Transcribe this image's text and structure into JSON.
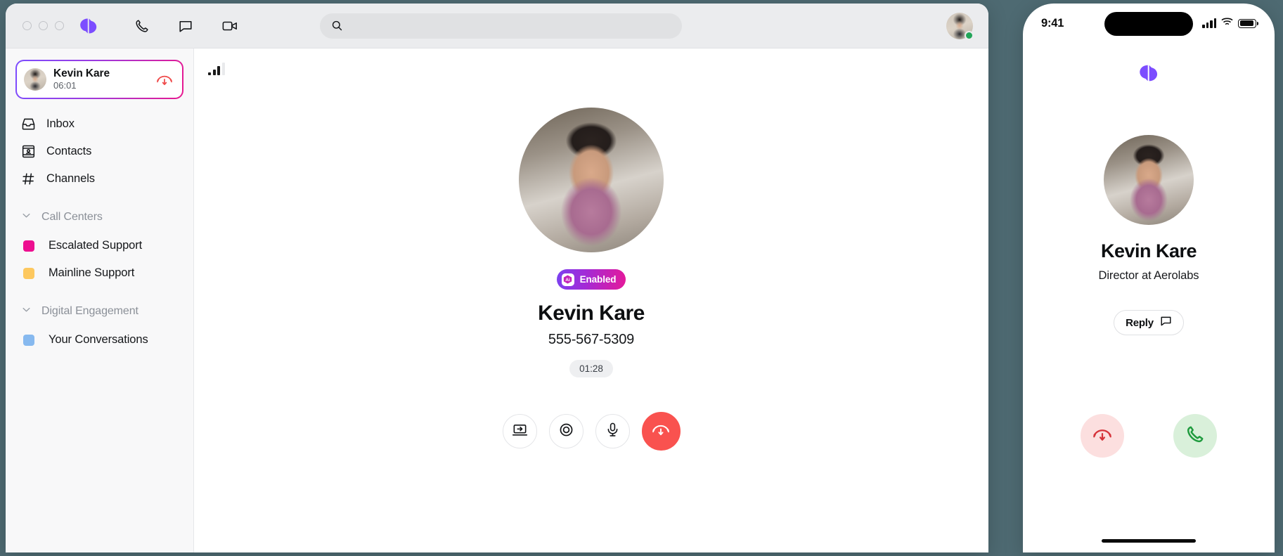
{
  "window": {
    "traffic_lights": [
      "close",
      "minimize",
      "zoom"
    ],
    "brand": "dialpad-logo",
    "toolbar_icons": [
      "phone-icon",
      "message-icon",
      "video-icon"
    ],
    "search": {
      "value": "",
      "placeholder": ""
    },
    "user_avatar": {
      "name": "avatar",
      "presence": "online",
      "presence_color": "#22a559"
    }
  },
  "sidebar": {
    "active_call": {
      "name": "Kevin Kare",
      "duration": "06:01",
      "hangup_icon": "hangup-icon",
      "border_gradient_from": "#7c4dff",
      "border_gradient_to": "#e8188f"
    },
    "nav": [
      {
        "label": "Inbox",
        "icon": "inbox-icon"
      },
      {
        "label": "Contacts",
        "icon": "contacts-icon"
      },
      {
        "label": "Channels",
        "icon": "hash-icon"
      }
    ],
    "sections": [
      {
        "title": "Call Centers",
        "chevron": "chevron-down-icon",
        "items": [
          {
            "label": "Escalated Support",
            "color": "#ed0f90"
          },
          {
            "label": "Mainline Support",
            "color": "#fdc85f"
          }
        ]
      },
      {
        "title": "Digital Engagement",
        "chevron": "chevron-down-icon",
        "items": [
          {
            "label": "Your Conversations",
            "color": "#87b9ef"
          }
        ]
      }
    ]
  },
  "call_main": {
    "signal": {
      "icon": "signal-strength-icon",
      "bars_total": 4,
      "bars_filled": 3
    },
    "avatar": "caller-avatar",
    "ai_badge": {
      "label": "Enabled",
      "icon": "ai-icon",
      "gradient_from": "#7b41f0",
      "gradient_to": "#e5199a"
    },
    "name": "Kevin Kare",
    "phone_number": "555-567-5309",
    "timer": "01:28",
    "controls": [
      {
        "name": "transfer-call-button",
        "icon": "transfer-icon"
      },
      {
        "name": "record-call-button",
        "icon": "record-icon"
      },
      {
        "name": "mute-button",
        "icon": "microphone-icon"
      },
      {
        "name": "end-call-button",
        "icon": "hangup-icon",
        "color": "#f9524f"
      }
    ]
  },
  "phone": {
    "status_bar": {
      "time": "9:41",
      "cellular": "cellular-signal-icon",
      "wifi": "wifi-icon",
      "battery": "battery-icon"
    },
    "logo": "dialpad-logo",
    "avatar": "caller-avatar",
    "name": "Kevin Kare",
    "role": "Director at Aerolabs",
    "reply_button": {
      "label": "Reply",
      "icon": "message-icon"
    },
    "actions": [
      {
        "name": "decline-call-button",
        "icon": "hangup-icon",
        "bg": "#fcdfdf",
        "fg": "#d6333a"
      },
      {
        "name": "accept-call-button",
        "icon": "phone-icon",
        "bg": "#d9f0da",
        "fg": "#1f9b3e"
      }
    ]
  },
  "background_color": "#4e6a72"
}
